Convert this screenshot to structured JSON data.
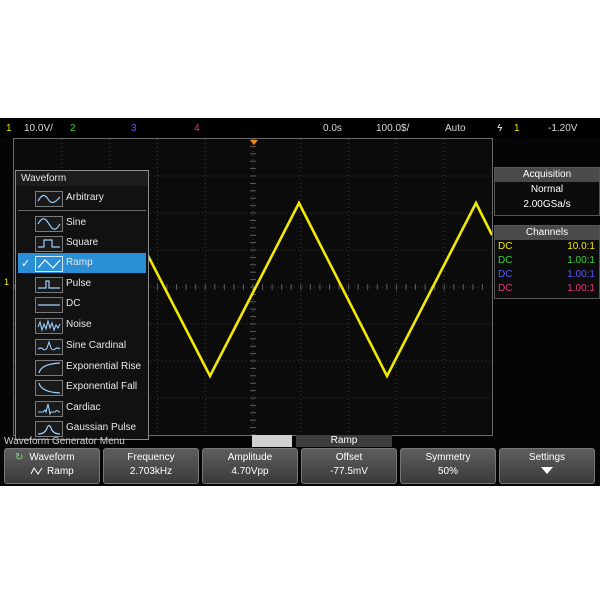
{
  "topbar": {
    "ch1_num": "1",
    "ch1_scale": "10.0V/",
    "ch2_num": "2",
    "ch3_num": "3",
    "ch4_num": "4",
    "timebase_delay": "0.0s",
    "timebase_scale": "100.0$/",
    "trigger_mode": "Auto",
    "trigger_channel": "1",
    "trigger_level": "-1.20V",
    "colors": {
      "ch1": "#f2e900",
      "ch2": "#3cd23c",
      "ch3": "#5a5af5",
      "ch4": "#e03a78"
    }
  },
  "acquisition": {
    "header": "Acquisition",
    "mode": "Normal",
    "sample_rate": "2.00GSa/s"
  },
  "channels": {
    "header": "Channels",
    "rows": [
      {
        "coupling": "DC",
        "probe": "10.0:1",
        "color": "#f2e900"
      },
      {
        "coupling": "DC",
        "probe": "1.00:1",
        "color": "#3cd23c"
      },
      {
        "coupling": "DC",
        "probe": "1.00:1",
        "color": "#5a5af5"
      },
      {
        "coupling": "DC",
        "probe": "1.00:1",
        "color": "#e03a78"
      }
    ]
  },
  "waveform_menu": {
    "title": "Waveform",
    "selected": "Ramp",
    "items": [
      {
        "label": "Arbitrary",
        "icon": "arbitrary-icon"
      },
      {
        "label": "Sine",
        "icon": "sine-icon"
      },
      {
        "label": "Square",
        "icon": "square-icon"
      },
      {
        "label": "Ramp",
        "icon": "ramp-icon",
        "check": "✓"
      },
      {
        "label": "Pulse",
        "icon": "pulse-icon"
      },
      {
        "label": "DC",
        "icon": "dc-icon"
      },
      {
        "label": "Noise",
        "icon": "noise-icon"
      },
      {
        "label": "Sine Cardinal",
        "icon": "sine-cardinal-icon"
      },
      {
        "label": "Exponential Rise",
        "icon": "exponential-rise-icon"
      },
      {
        "label": "Exponential Fall",
        "icon": "exponential-fall-icon"
      },
      {
        "label": "Cardiac",
        "icon": "cardiac-icon"
      },
      {
        "label": "Gaussian Pulse",
        "icon": "gaussian-pulse-icon"
      }
    ]
  },
  "footer": {
    "status_text": "Waveform Generator Menu",
    "menu_name": "Ramp"
  },
  "softkeys": [
    {
      "title": "Waveform",
      "value": "Ramp",
      "icon": "ramp-icon"
    },
    {
      "title": "Frequency",
      "value": "2.703kHz"
    },
    {
      "title": "Amplitude",
      "value": "4.70Vpp"
    },
    {
      "title": "Offset",
      "value": "-77.5mV"
    },
    {
      "title": "Symmetry",
      "value": "50%"
    },
    {
      "title": "Settings",
      "icon": "arrow-down-icon"
    }
  ],
  "trace": {
    "color": "#f2e900",
    "channel_marker": "1"
  }
}
